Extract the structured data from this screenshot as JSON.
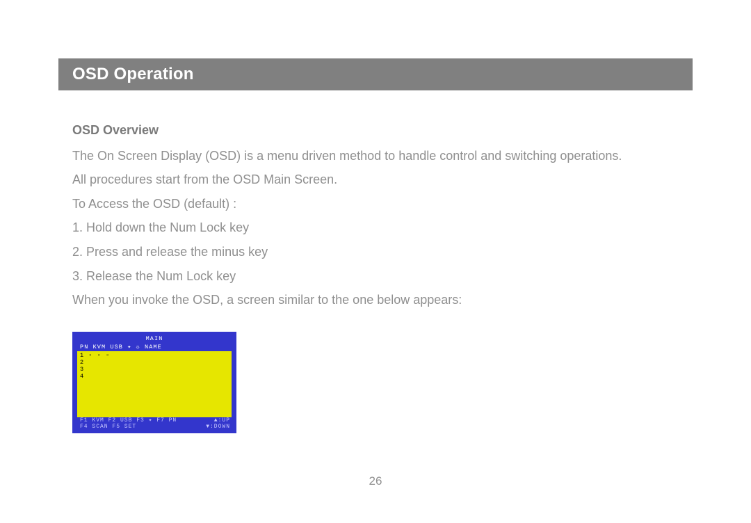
{
  "header": {
    "title": "OSD Operation"
  },
  "section": {
    "subheading": "OSD Overview",
    "line1": "The On Screen Display (OSD) is a menu driven method to handle control and switching operations.",
    "line2": "All procedures start from the OSD Main Screen.",
    "line3": "To Access the OSD (default) :",
    "step1": "1. Hold down the Num Lock key",
    "step2": "2. Press and release the minus key",
    "step3": "3. Release the Num Lock key",
    "line4": "When you invoke the OSD, a screen similar to the one below appears:"
  },
  "osd": {
    "title": "MAIN",
    "cols": "PN  KVM  USB  ✦  ☼  NAME",
    "rows": {
      "r1": "1    ▫    ▫   ▫",
      "r2": "2",
      "r3": "3",
      "r4": "4"
    },
    "footer": {
      "f1a": "F1 KVM  F2 USB  F3 ✦  F7 PN",
      "f1b": "▲:UP",
      "f2a": "F4 SCAN  F5 SET",
      "f2b": "▼:DOWN"
    }
  },
  "page_number": "26"
}
